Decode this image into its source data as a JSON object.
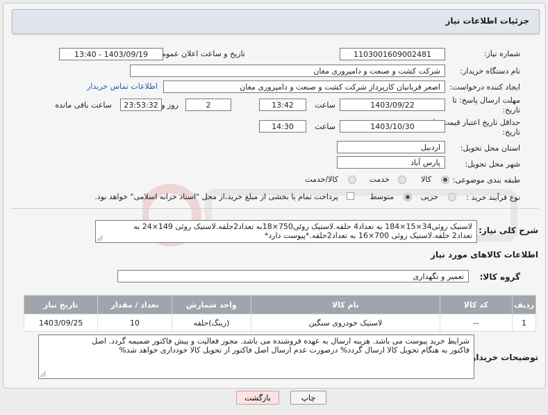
{
  "header": {
    "title": "جزئیات اطلاعات نیاز"
  },
  "need_number": {
    "label": "شماره نیاز:",
    "value": "1103001609002481"
  },
  "announce": {
    "label": "تاریخ و ساعت اعلان عمومی:",
    "value": "1403/09/19 - 13:40"
  },
  "buyer": {
    "label": "نام دستگاه خریدار:",
    "value": "شرکت کشت و صنعت و دامپروری مغان"
  },
  "creator": {
    "label": "ایجاد کننده درخواست:",
    "value": "اصغر قربانیان کارپرداز شرکت کشت و صنعت و دامپروری مغان",
    "contact_link": "اطلاعات تماس خریدار"
  },
  "deadline": {
    "label_line1": "مهلت ارسال پاسخ: تا",
    "label_line2": "تاریخ:",
    "date": "1403/09/22",
    "time_label": "ساعت",
    "time": "13:42",
    "days": "2",
    "days_label": "روز و",
    "remaining": "23:53:32",
    "remaining_label": "ساعت باقی مانده"
  },
  "validity": {
    "label_line1": "حداقل تاریخ اعتبار قیمت: تا",
    "label_line2": "تاریخ:",
    "date": "1403/10/30",
    "time_label": "ساعت",
    "time": "14:30"
  },
  "province": {
    "label": "استان محل تحویل:",
    "value": "اردبیل"
  },
  "city": {
    "label": "شهر محل تحویل:",
    "value": "پارس آباد"
  },
  "category": {
    "label": "طبقه بندی موضوعی:",
    "options": [
      "کالا",
      "خدمت",
      "کالا/خدمت"
    ],
    "selected": "کالا"
  },
  "process": {
    "label": "نوع فرآیند خرید :",
    "options": [
      "جزیی",
      "متوسط"
    ],
    "note": "پرداخت تمام یا بخشی از مبلغ خرید،از محل \"اسناد خزانه اسلامی\" خواهد بود."
  },
  "description": {
    "label": "شرح کلی نیاز:",
    "line1": "لاستیک روئی34×15×184 به تعداد4 حلقه.لاستیک روئی750×18به تعداد2حلقه.لاستیک روئی 149×24 به",
    "line2": "تعداد2 حلقه.لاستیک روئی 700×16 به تعداد2حلقه.*پیوست دارد*"
  },
  "goods_info": {
    "title": "اطلاعات کالاهای مورد نیاز"
  },
  "goods_group": {
    "label": "گروه کالا:",
    "value": "تعمیر و نگهداری"
  },
  "table": {
    "headers": [
      "ردیف",
      "کد کالا",
      "نام کالا",
      "واحد شمارش",
      "تعداد / مقدار",
      "تاریخ نیاز"
    ],
    "rows": [
      [
        "1",
        "--",
        "لاستیک خودروی سنگین",
        "(رینگ)حلقه",
        "10",
        "1403/09/25"
      ]
    ]
  },
  "buyer_notes": {
    "label": "توضیحات خریدار:",
    "line1": "شرایط خرید پیوست می باشد. هزینه ارسال به عهده فروشنده می باشد. مجوز فعالیت و پیش فاکتور ضمیمه گردد. اصل",
    "line2": "فاکتور به هنگام تحویل کالا ارسال گردد% درصورت عدم ارسال اصل فاکتور از تحویل کالا خودداری خواهد شد%"
  },
  "buttons": {
    "print": "چاپ",
    "back": "بازگشت"
  },
  "colors": {
    "header_bg": "#e1e6ed",
    "table_header": "#a0a4ab",
    "link": "#1f5fb0",
    "back_button": "#fbe3e3"
  }
}
